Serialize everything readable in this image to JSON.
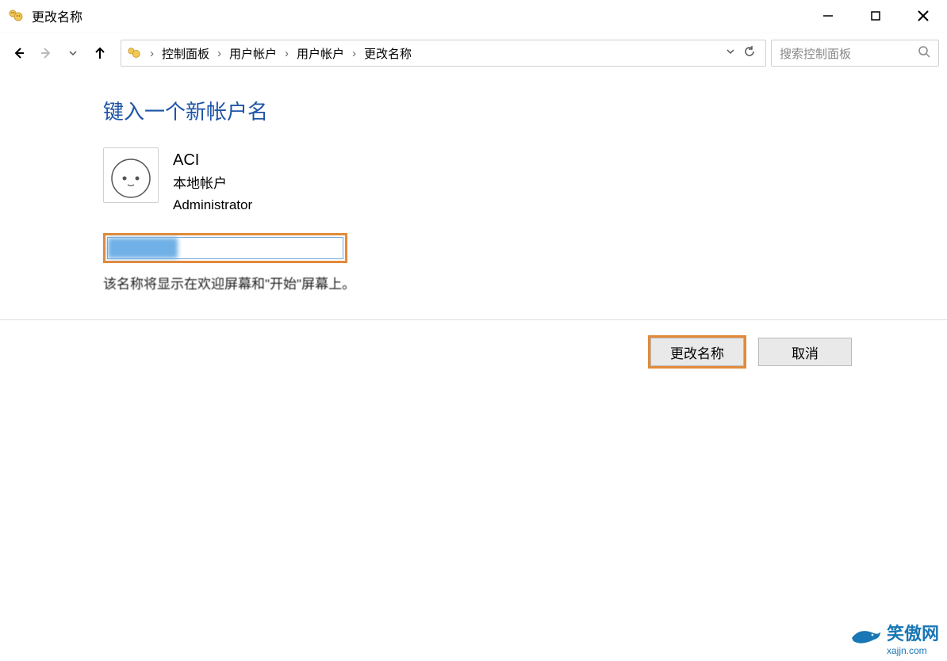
{
  "window": {
    "title": "更改名称"
  },
  "breadcrumbs": {
    "items": [
      "控制面板",
      "用户帐户",
      "用户帐户",
      "更改名称"
    ]
  },
  "search": {
    "placeholder": "搜索控制面板"
  },
  "page": {
    "heading": "键入一个新帐户名",
    "account_name": "ACI",
    "account_type": "本地帐户",
    "account_role": "Administrator",
    "hint": "该名称将显示在欢迎屏幕和\"开始\"屏幕上。"
  },
  "buttons": {
    "rename": "更改名称",
    "cancel": "取消"
  },
  "watermark": {
    "name": "笑傲网",
    "url": "xajjn.com"
  }
}
